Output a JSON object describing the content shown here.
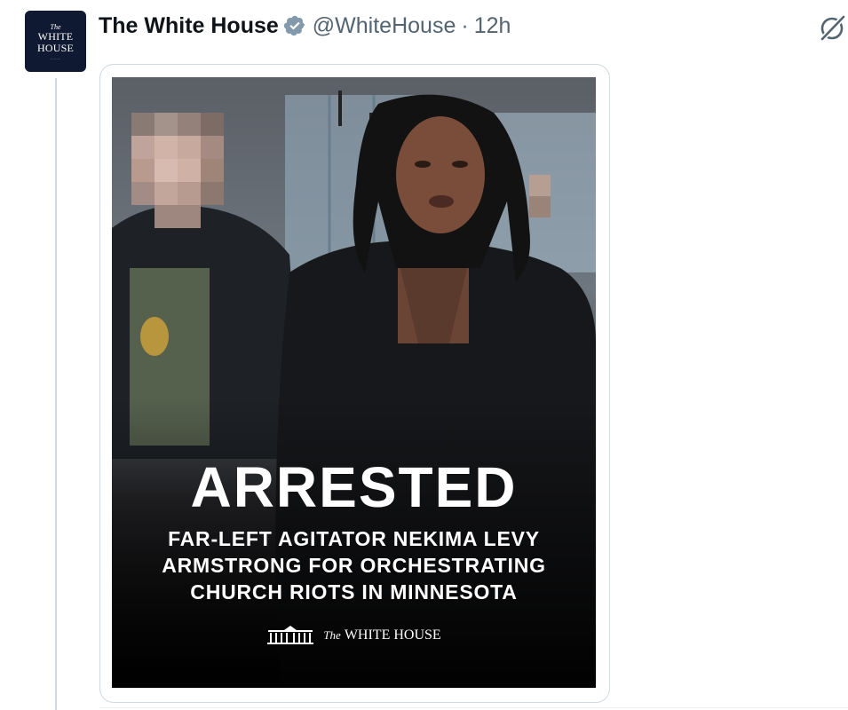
{
  "tweet": {
    "author": {
      "display_name": "The White House",
      "handle": "@WhiteHouse",
      "verified_icon": "verified-badge-icon",
      "avatar": {
        "line1": "The",
        "line2": "WHITE",
        "line3": "HOUSE"
      }
    },
    "separator": "·",
    "timestamp": "12h",
    "menu_icon": "grok-icon",
    "media": {
      "headline": "ARRESTED",
      "subtitle_lines": [
        "FAR-LEFT AGITATOR NEKIMA LEVY",
        "ARMSTRONG FOR ORCHESTRATING",
        "CHURCH RIOTS IN MINNESOTA"
      ],
      "brand_prefix": "The",
      "brand_name": "WHITE HOUSE"
    }
  },
  "colors": {
    "avatar_bg": "#101932",
    "verified_badge": "#829aab",
    "secondary_text": "#536471",
    "border": "#cfd9de"
  }
}
